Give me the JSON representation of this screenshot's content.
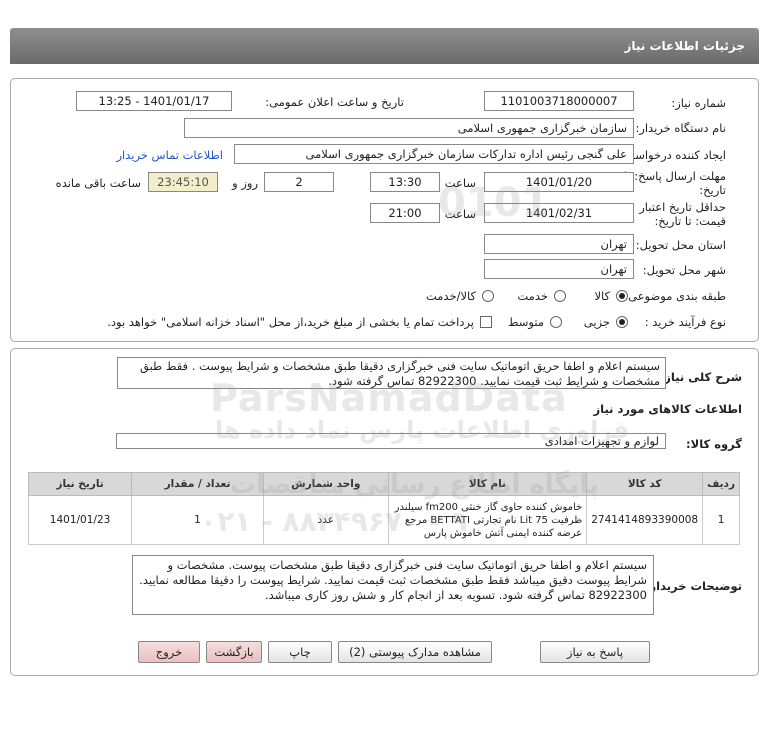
{
  "header": {
    "title": "جزئیات اطلاعات نیاز"
  },
  "info": {
    "need_number_label": "شماره نیاز:",
    "need_number": "1101003718000007",
    "announce_label": "تاریخ و ساعت اعلان عمومی:",
    "announce_value": "1401/01/17 - 13:25",
    "buyer_label": "نام دستگاه خریدار:",
    "buyer_value": "سازمان خبرگزاری جمهوری اسلامی",
    "creator_label": "ایجاد کننده درخواست:",
    "creator_value": "علی گنجی رئیس اداره تدارکات سازمان خبرگزاری جمهوری اسلامی",
    "contact_link": "اطلاعات تماس خریدار",
    "deadline_label_1": "مهلت ارسال پاسخ: تا",
    "deadline_label_2": "تاریخ:",
    "deadline_date": "1401/01/20",
    "time_label": "ساعت",
    "deadline_time": "13:30",
    "days_value": "2",
    "days_label": "روز و",
    "remaining_value": "23:45:10",
    "remaining_label": "ساعت باقی مانده",
    "validity_label_1": "حداقل تاریخ اعتبار",
    "validity_label_2": "قیمت: تا تاریخ:",
    "validity_date": "1401/02/31",
    "validity_time": "21:00",
    "delivery_province_label": "استان محل تحویل:",
    "delivery_province": "تهران",
    "delivery_city_label": "شهر محل تحویل:",
    "delivery_city": "تهران",
    "category_label": "طبقه بندی موضوعی:",
    "category_options": [
      "کالا",
      "خدمت",
      "کالا/خدمت"
    ],
    "process_label": "نوع فرآیند خرید :",
    "process_options": [
      "جزیی",
      "متوسط"
    ],
    "payment_note": "پرداخت تمام یا بخشی از مبلغ خرید،از محل \"اسناد خزانه اسلامی\" خواهد بود."
  },
  "details": {
    "general_desc_label": "شرح کلی نیاز:",
    "general_desc": "سیستم اعلام و اطفا حریق اتوماتیک سایت فنی خبرگزاری دقیقا طبق مشخصات و شرایط پیوست . فقط طبق مشخصات و شرایط ثبت قیمت نمایید. 82922300 تماس گرفته شود.",
    "goods_info_title": "اطلاعات کالاهای مورد نیاز",
    "goods_group_label": "گروه کالا:",
    "goods_group": "لوازم و تجهیزات امدادی",
    "table": {
      "headers": [
        "ردیف",
        "کد کالا",
        "نام کالا",
        "واحد شمارش",
        "تعداد / مقدار",
        "تاریخ نیاز"
      ],
      "rows": [
        {
          "row": "1",
          "code": "2741414893390008",
          "name": "خاموش کننده حاوی گاز خنثی fm200 سیلندر ظرفیت Lit 75 نام تجارتی BETTATI مرجع عرضه کننده ایمنی آتش خاموش پارس",
          "unit": "عدد",
          "qty": "1",
          "date": "1401/01/23"
        }
      ]
    },
    "buyer_notes_label": "توضیحات خریدار:",
    "buyer_notes": "سیستم اعلام و اطفا حریق اتوماتیک سایت فنی خبرگزاری دقیقا طبق مشخصات پیوست. مشخصات و شرایط پیوست دقیق میباشد فقط طبق مشخصات ثبت قیمت نمایید. شرایط پیوست را دقیقا مطالعه نمایید. 82922300 تماس گرفته شود. تسویه بعد از انجام کار و شش روز کاری میباشد."
  },
  "buttons": {
    "reply": "پاسخ به نیاز",
    "attachments": "مشاهده مدارک پیوستی (2)",
    "print": "چاپ",
    "back": "بازگشت",
    "exit": "خروج"
  },
  "watermark": {
    "brand": "ParsNamadData",
    "line1": "پایگاه اطلاع رسانی مناقصات",
    "line2": "فراوری اطلاعات پارس نماد داده ها",
    "phone": "۰۲۱ - ۸۸۳۴۹۶۷۰ - ۹",
    "digits": "0101"
  }
}
